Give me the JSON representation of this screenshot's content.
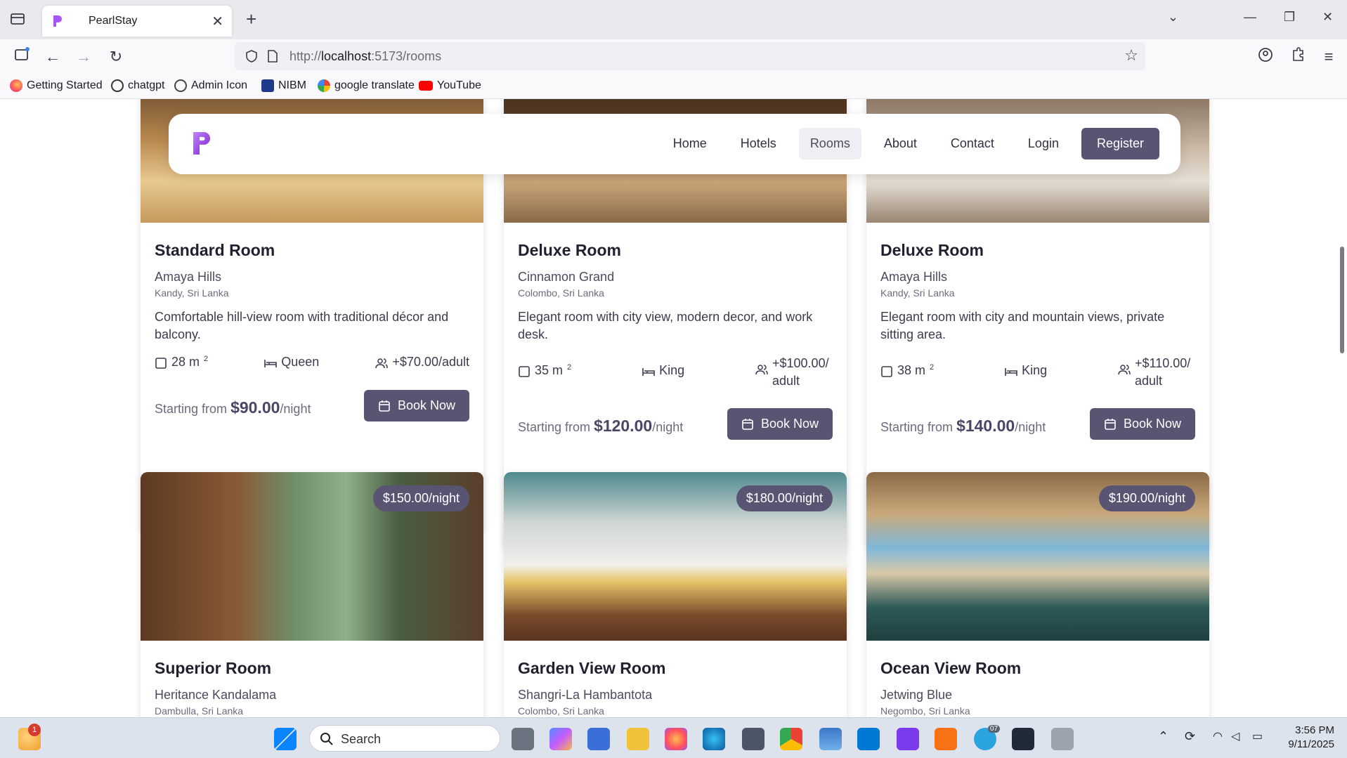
{
  "browser": {
    "tab_title": "PearlStay",
    "url_prefix": "http://",
    "url_host": "localhost",
    "url_rest": ":5173/rooms",
    "bookmarks": [
      "Getting Started",
      "chatgpt",
      "Admin Icon",
      "NIBM",
      "google translate",
      "YouTube"
    ]
  },
  "site": {
    "logo_letter": "P",
    "nav": [
      "Home",
      "Hotels",
      "Rooms",
      "About",
      "Contact",
      "Login"
    ],
    "active_nav": "Rooms",
    "register_label": "Register",
    "accent_color": "#5a5473"
  },
  "rooms": [
    {
      "name": "Standard Room",
      "hotel": "Amaya Hills",
      "location": "Kandy, Sri Lanka",
      "description": "Comfortable hill-view room with traditional décor and balcony.",
      "size": "28 m",
      "bed": "Queen",
      "extra": "+$70.00/adult",
      "starting_label": "Starting from",
      "price": "$90.00",
      "per": "/night",
      "book_label": "Book Now"
    },
    {
      "name": "Deluxe Room",
      "hotel": "Cinnamon Grand",
      "location": "Colombo, Sri Lanka",
      "description": "Elegant room with city view, modern decor, and work desk.",
      "size": "35 m",
      "bed": "King",
      "extra": "+$100.00/ adult",
      "starting_label": "Starting from",
      "price": "$120.00",
      "per": "/night",
      "book_label": "Book Now"
    },
    {
      "name": "Deluxe Room",
      "hotel": "Amaya Hills",
      "location": "Kandy, Sri Lanka",
      "description": "Elegant room with city and mountain views, private sitting area.",
      "size": "38 m",
      "bed": "King",
      "extra": "+$110.00/ adult",
      "starting_label": "Starting from",
      "price": "$140.00",
      "per": "/night",
      "book_label": "Book Now"
    },
    {
      "name": "Superior Room",
      "hotel": "Heritance Kandalama",
      "location": "Dambulla, Sri Lanka",
      "badge": "$150.00/night"
    },
    {
      "name": "Garden View Room",
      "hotel": "Shangri-La Hambantota",
      "location": "Colombo, Sri Lanka",
      "badge": "$180.00/night"
    },
    {
      "name": "Ocean View Room",
      "hotel": "Jetwing Blue",
      "location": "Negombo, Sri Lanka",
      "badge": "$190.00/night"
    }
  ],
  "taskbar": {
    "search_placeholder": "Search",
    "time": "3:56 PM",
    "date": "9/11/2025",
    "notification_count": "1",
    "telegram_badge": "07"
  }
}
